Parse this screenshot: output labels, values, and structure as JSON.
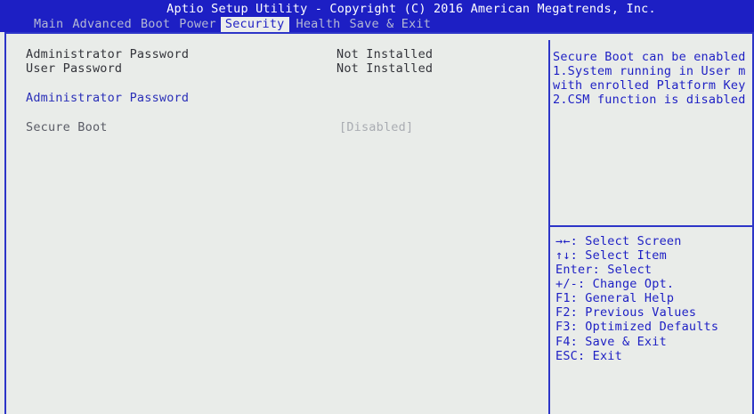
{
  "header": {
    "title": "Aptio Setup Utility - Copyright (C) 2016 American Megatrends, Inc.",
    "tabs": [
      "Main",
      "Advanced",
      "Boot",
      "Power",
      "Security",
      "Health",
      "Save & Exit"
    ],
    "active_tab": "Security"
  },
  "settings": {
    "admin_password_label": "Administrator Password",
    "admin_password_value": "Not Installed",
    "user_password_label": "User Password",
    "user_password_value": "Not Installed",
    "admin_password_action": "Administrator Password",
    "secure_boot_label": "Secure Boot",
    "secure_boot_value": "[Disabled]"
  },
  "help": {
    "lines": [
      "Secure Boot can be enabled",
      "1.System running in User m",
      "with enrolled Platform Key",
      "2.CSM function is disabled"
    ]
  },
  "keys": [
    "→←: Select Screen",
    "↑↓: Select Item",
    "Enter: Select",
    "+/-: Change Opt.",
    "F1: General Help",
    "F2: Previous Values",
    "F3: Optimized Defaults",
    "F4: Save & Exit",
    "ESC: Exit"
  ],
  "colors": {
    "header_bg": "#1d1fc4",
    "panel_bg": "#e9ece9",
    "accent_text": "#1d1fc4",
    "muted_tab_text": "#b4b8d4"
  }
}
